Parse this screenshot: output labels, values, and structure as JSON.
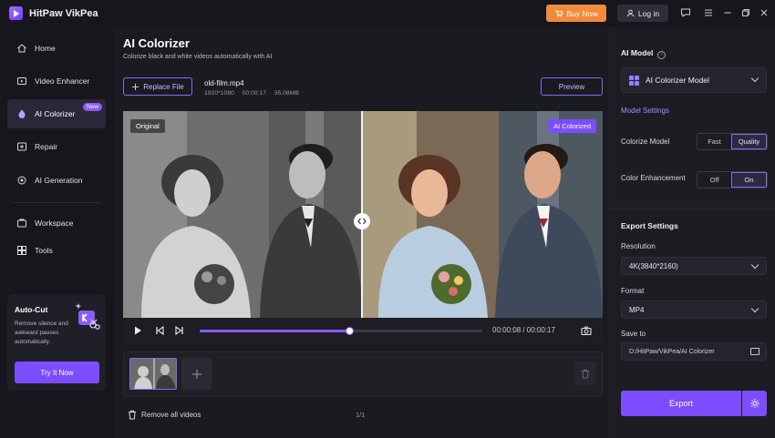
{
  "app": {
    "title": "HitPaw VikPea",
    "buy_label": "Buy Now",
    "login_label": "Log in"
  },
  "sidebar": {
    "items": [
      {
        "label": "Home",
        "icon": "home-icon"
      },
      {
        "label": "Video Enhancer",
        "icon": "video-enhancer-icon"
      },
      {
        "label": "AI Colorizer",
        "icon": "palette-icon",
        "badge": "New",
        "active": true
      },
      {
        "label": "Repair",
        "icon": "repair-icon"
      },
      {
        "label": "AI Generation",
        "icon": "ai-generation-icon"
      },
      {
        "label": "Workspace",
        "icon": "workspace-icon"
      },
      {
        "label": "Tools",
        "icon": "tools-icon"
      }
    ],
    "promo": {
      "title": "Auto-Cut",
      "description": "Remove silence and awkward pauses automatically.",
      "button_label": "Try It Now"
    }
  },
  "main": {
    "title": "AI Colorizer",
    "subtitle": "Colorize black and white videos automatically with AI",
    "replace_label": "Replace File",
    "preview_label": "Preview",
    "file": {
      "name": "old-film.mp4",
      "resolution": "1920*1080",
      "duration": "00:00:17",
      "size": "35.08MB"
    },
    "video": {
      "original_label": "Original",
      "colorized_label": "AI Colorized"
    },
    "player": {
      "current_time": "00:00:08",
      "total_time": "00:00:17",
      "time_display": "00:00:08 / 00:00:17",
      "progress": 0.53
    },
    "remove_all_label": "Remove all videos",
    "counter": "1/1"
  },
  "panel": {
    "ai_model_heading": "AI Model",
    "model_selected": "AI Colorizer Model",
    "model_settings_label": "Model Settings",
    "colorize_model": {
      "label": "Colorize Model",
      "options": [
        "Fast",
        "Quality"
      ],
      "selected": "Quality"
    },
    "color_enhancement": {
      "label": "Color Enhancement",
      "options": [
        "Off",
        "On"
      ],
      "selected": "On"
    },
    "export_settings_heading": "Export Settings",
    "resolution": {
      "label": "Resolution",
      "value": "4K(3840*2160)"
    },
    "format": {
      "label": "Format",
      "value": "MP4"
    },
    "save_to": {
      "label": "Save to",
      "value": "D:/HitPaw/VikPea/AI Colorizer"
    },
    "export_label": "Export"
  },
  "colors": {
    "accent": "#7c4dff",
    "buy": "#f08a3c",
    "background": "#16161c"
  }
}
